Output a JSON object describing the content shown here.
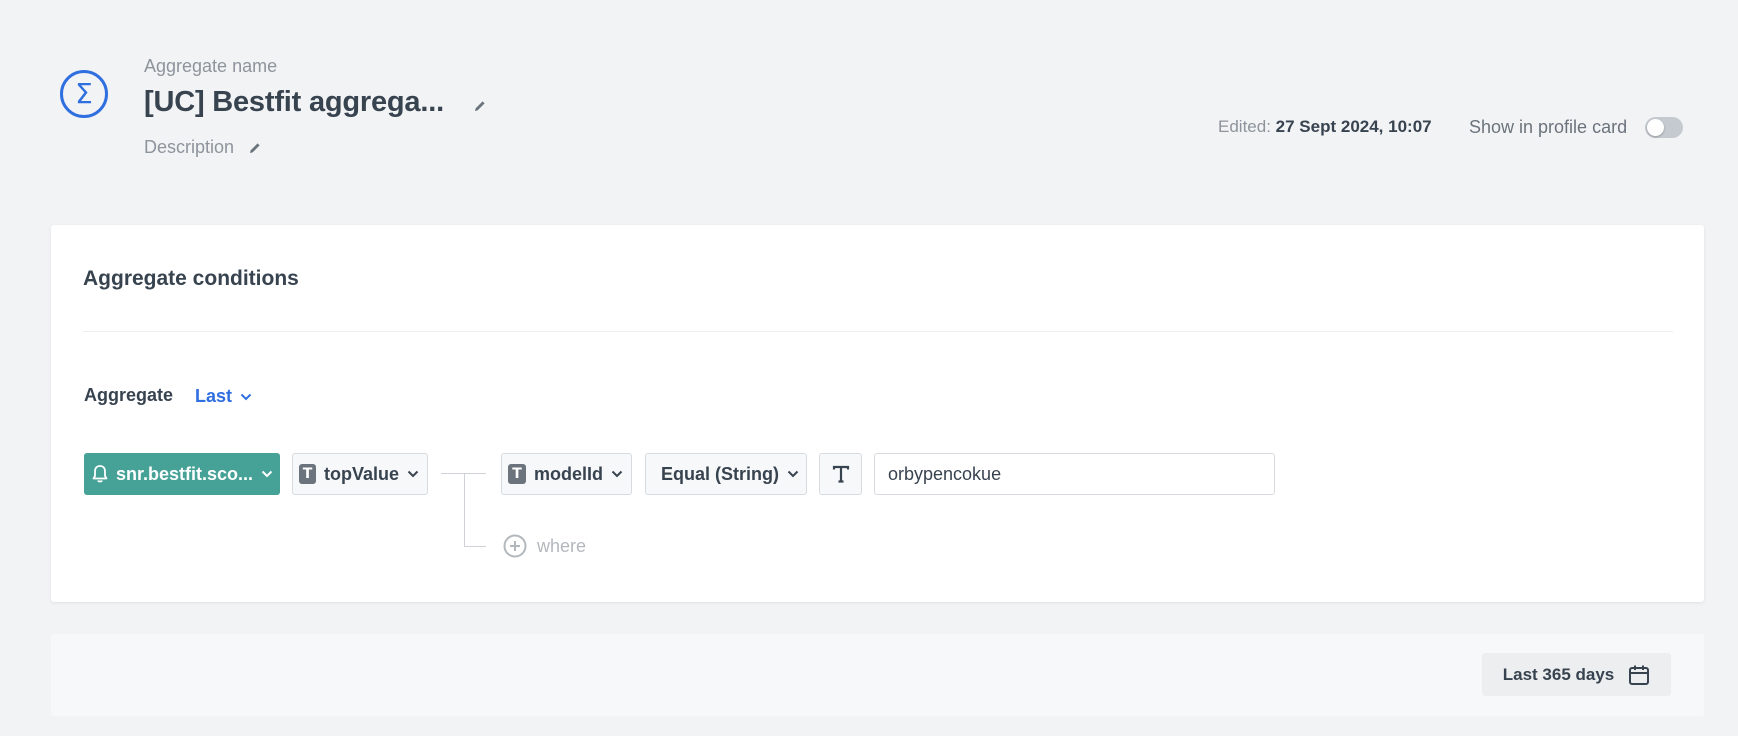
{
  "header": {
    "aggregate_name_label": "Aggregate name",
    "title": "[UC] Bestfit aggrega...",
    "description_label": "Description",
    "edited_label": "Edited:",
    "edited_value": "27 Sept 2024, 10:07",
    "show_in_profile_label": "Show in profile card",
    "show_in_profile_enabled": false,
    "icons": {
      "aggregate": "sigma-icon",
      "edit": "pencil-icon"
    },
    "accent_color": "#2f6fe0"
  },
  "conditions": {
    "title": "Aggregate conditions",
    "aggregate_label": "Aggregate",
    "aggregate_type": "Last",
    "event": {
      "label": "snr.bestfit.sco...",
      "icon": "bell-icon",
      "color": "#46a196"
    },
    "parameter": {
      "label": "topValue",
      "icon": "text-type-icon"
    },
    "filter": {
      "field": "modelId",
      "operator": "Equal (String)",
      "value_type_icon": "text-type-icon",
      "value": "orbypencokue"
    },
    "add_where_label": "where"
  },
  "footer": {
    "date_range_label": "Last 365 days",
    "date_range_icon": "calendar-icon"
  }
}
